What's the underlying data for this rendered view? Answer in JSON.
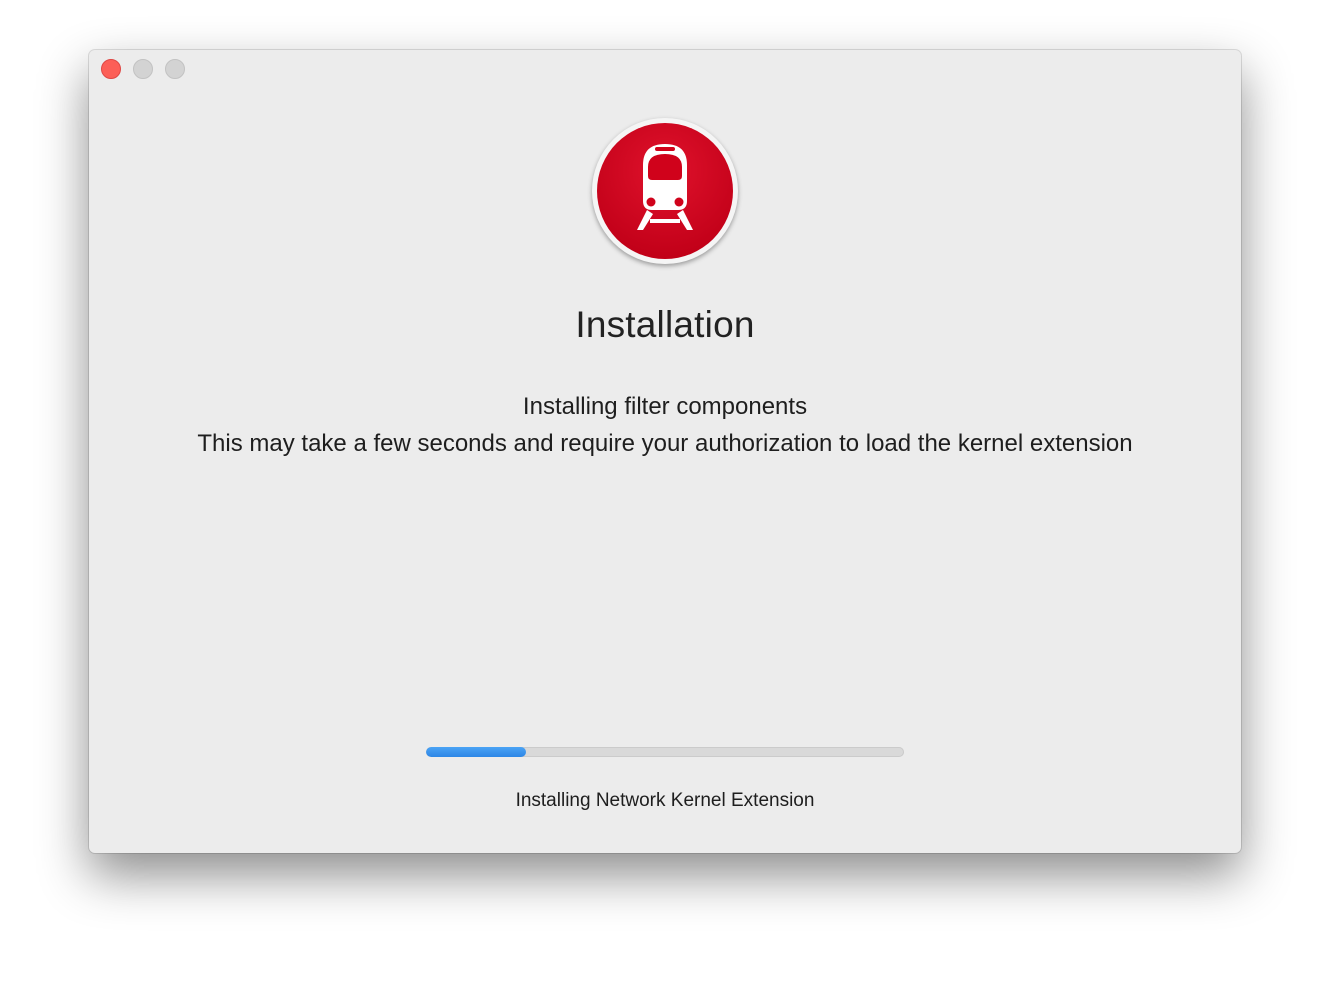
{
  "window": {
    "controls": {
      "close": "close-button",
      "minimize": "minimize-button",
      "zoom": "zoom-button"
    }
  },
  "app_icon": {
    "name": "train-icon",
    "background_color": "#d0021b",
    "glyph_color": "#ffffff"
  },
  "content": {
    "title": "Installation",
    "subtitle_line1": "Installing filter components",
    "subtitle_line2": "This may take a few seconds and require your authorization to load the kernel extension"
  },
  "progress": {
    "fraction": 0.21,
    "fill_color": "#3a93ee",
    "status_text": "Installing Network Kernel Extension"
  }
}
